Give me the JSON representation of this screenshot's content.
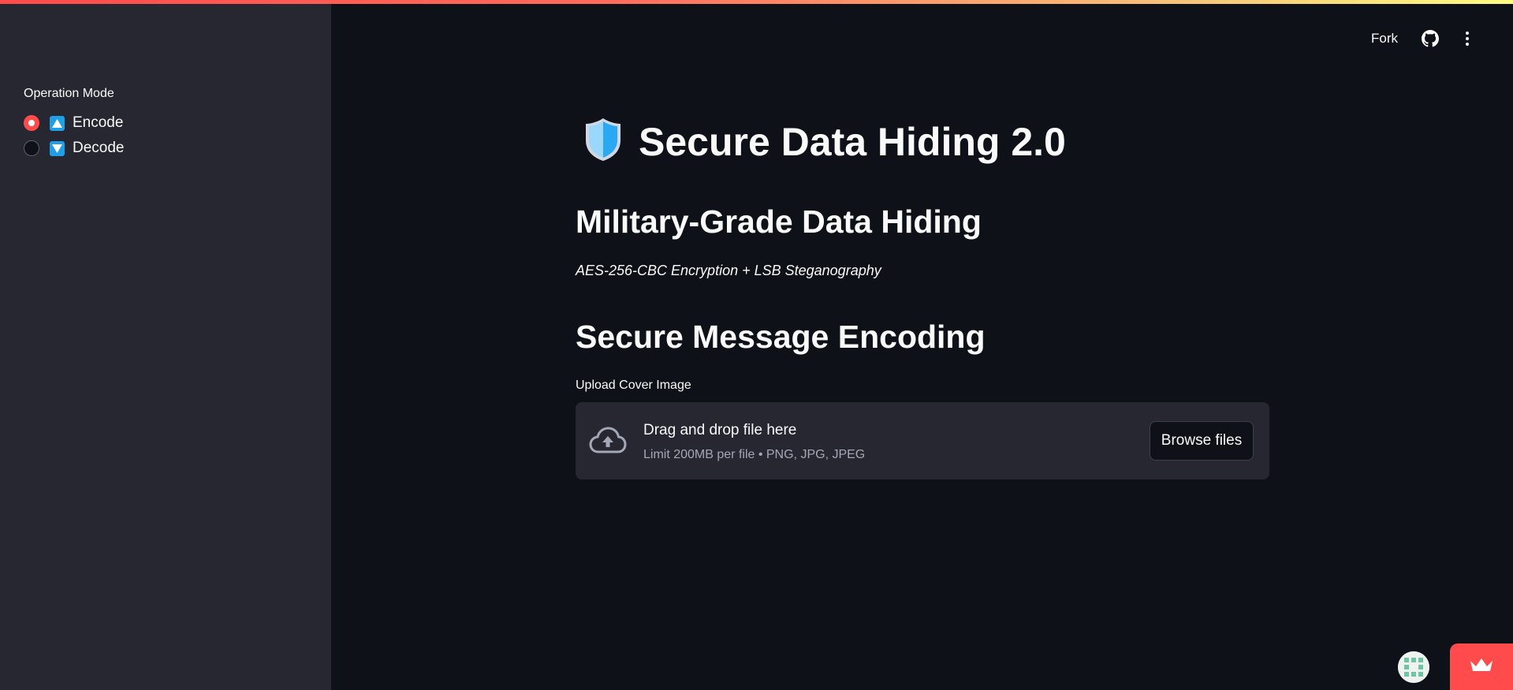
{
  "sidebar": {
    "label": "Operation Mode",
    "options": [
      {
        "label": "Encode",
        "selected": true,
        "icon": "up-triangle-icon"
      },
      {
        "label": "Decode",
        "selected": false,
        "icon": "down-triangle-icon"
      }
    ]
  },
  "header": {
    "fork_label": "Fork",
    "github_icon": "github-icon",
    "menu_icon": "kebab-menu-icon"
  },
  "main": {
    "title": "Secure Data Hiding 2.0",
    "title_icon": "shield-icon",
    "heading": "Military-Grade Data Hiding",
    "subtitle": "AES-256-CBC Encryption + LSB Steganography",
    "section_heading": "Secure Message Encoding",
    "upload": {
      "label": "Upload Cover Image",
      "drop_text": "Drag and drop file here",
      "limit_text": "Limit 200MB per file • PNG, JPG, JPEG",
      "browse_label": "Browse files"
    }
  },
  "colors": {
    "accent": "#ff4b4b",
    "background": "#0e1117",
    "sidebar": "#262730",
    "emoji_blue": "#1e9fe6"
  }
}
